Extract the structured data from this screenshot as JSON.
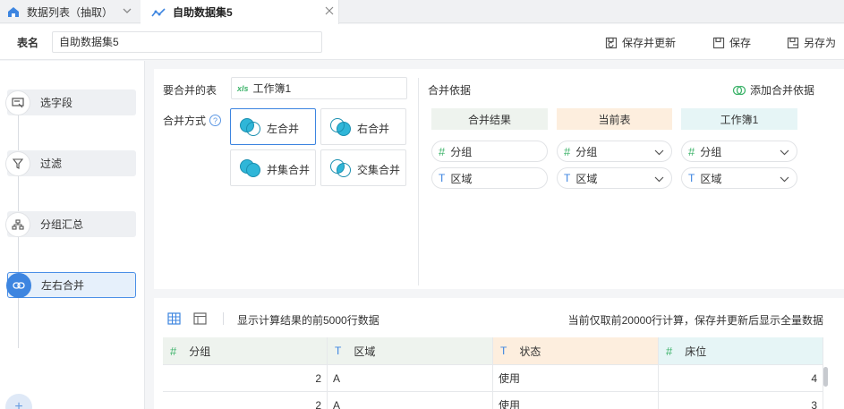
{
  "tabs": [
    {
      "label": "数据列表（抽取）",
      "icon": "home-icon"
    },
    {
      "label": "自助数据集5",
      "icon": "trend-icon"
    }
  ],
  "toolbar": {
    "table_name_label": "表名",
    "table_name_value": "自助数据集5",
    "save_update_label": "保存并更新",
    "save_label": "保存",
    "save_as_label": "另存为"
  },
  "steps": [
    {
      "label": "选字段",
      "icon": "select-field-icon"
    },
    {
      "label": "过滤",
      "icon": "filter-icon"
    },
    {
      "label": "分组汇总",
      "icon": "group-icon"
    },
    {
      "label": "左右合并",
      "icon": "merge-icon",
      "active": true
    }
  ],
  "config": {
    "table_label": "要合并的表",
    "table_value": "工作簿1",
    "table_icon_text": "xls",
    "mode_label": "合并方式",
    "modes": [
      "左合并",
      "右合并",
      "并集合并",
      "交集合并"
    ],
    "selected_mode": "左合并",
    "basis_title": "合并依据",
    "add_basis_label": "添加合并依据",
    "columns": [
      "合并结果",
      "当前表",
      "工作簿1"
    ],
    "column_colors": [
      "#eef3ee",
      "#fdeede",
      "#e6f5f6"
    ],
    "rows": [
      {
        "type": "#",
        "result": "分组",
        "current": "分组",
        "other": "分组"
      },
      {
        "type": "T",
        "result": "区域",
        "current": "区域",
        "other": "区域"
      }
    ]
  },
  "preview": {
    "info": "显示计算结果的前5000行数据",
    "note": "当前仅取前20000行计算，保存并更新后显示全量数据",
    "headers": [
      {
        "type": "#",
        "label": "分组",
        "color": "#eef3ee"
      },
      {
        "type": "T",
        "label": "区域",
        "color": "#eef3ee"
      },
      {
        "type": "T",
        "label": "状态",
        "color": "#fdeede"
      },
      {
        "type": "#",
        "label": "床位",
        "color": "#e6f5f6"
      }
    ],
    "rows": [
      [
        "2",
        "A",
        "使用",
        "4"
      ],
      [
        "2",
        "A",
        "使用",
        "3"
      ]
    ]
  }
}
